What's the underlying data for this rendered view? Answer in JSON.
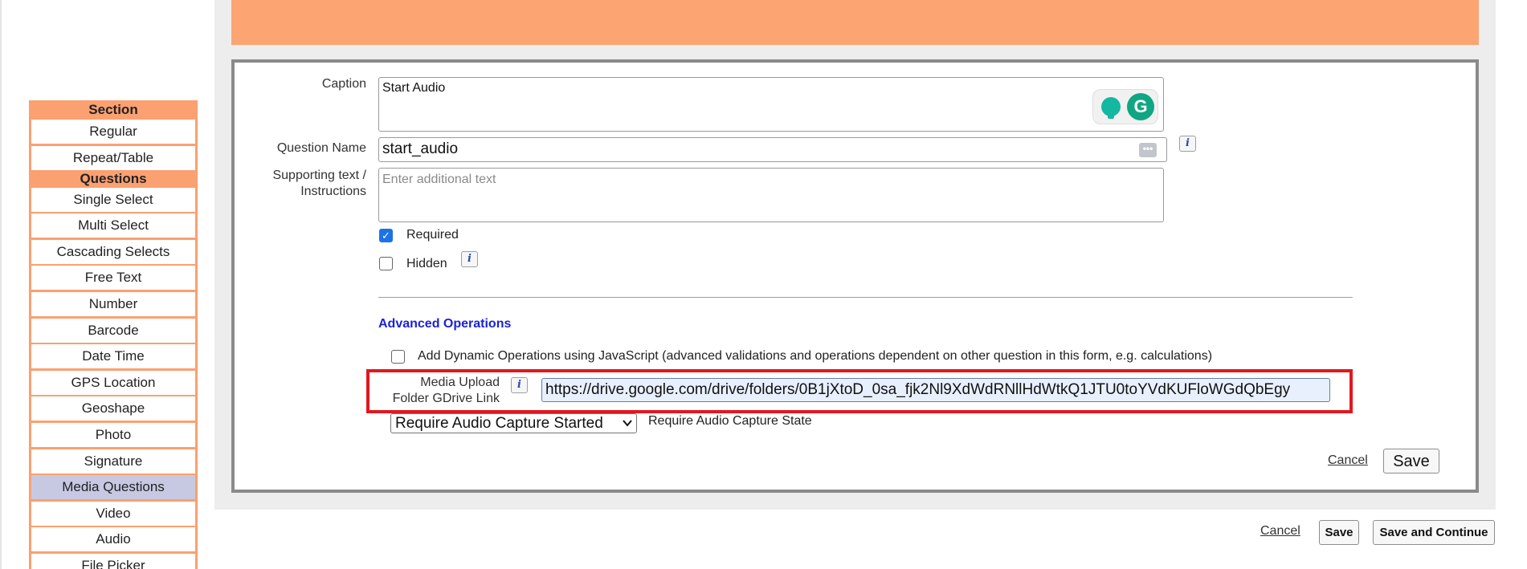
{
  "sidebar": {
    "section_header": "Section",
    "section_items": [
      "Regular",
      "Repeat/Table"
    ],
    "questions_header": "Questions",
    "question_items": [
      "Single Select",
      "Multi Select",
      "Cascading Selects",
      "Free Text",
      "Number",
      "Barcode",
      "Date Time",
      "GPS Location",
      "Geoshape",
      "Photo",
      "Signature",
      "Media Questions",
      "Video",
      "Audio",
      "File Picker"
    ],
    "active_item": "Media Questions"
  },
  "form": {
    "caption_label": "Caption",
    "caption_value": "Start Audio",
    "question_name_label": "Question Name",
    "question_name_value": "start_audio",
    "supporting_label_line1": "Supporting text /",
    "supporting_label_line2": "Instructions",
    "supporting_placeholder": "Enter additional text",
    "required_label": "Required",
    "required_checked": true,
    "hidden_label": "Hidden",
    "hidden_checked": false,
    "advanced_title": "Advanced Operations",
    "dynamic_ops_label": "Add Dynamic Operations using JavaScript (advanced validations and operations dependent on other question in this form, e.g. calculations)",
    "media_label_line1": "Media Upload",
    "media_label_line2": "Folder GDrive Link",
    "media_link_value": "https://drive.google.com/drive/folders/0B1jXtoD_0sa_fjk2Nl9XdWdRNllHdWtkQ1JTU0toYVdKUFloWGdQbEgy",
    "audio_state_selected": "Require Audio Capture Started",
    "audio_state_label": "Require Audio Capture State",
    "cancel_label": "Cancel",
    "save_label": "Save"
  },
  "footer": {
    "cancel_label": "Cancel",
    "save_label": "Save",
    "save_continue_label": "Save and Continue"
  },
  "colors": {
    "sidebar_accent": "#fba070",
    "banner": "#fca572",
    "active_item": "#c7c9e3",
    "highlight_box": "#e2171f",
    "advanced_title": "#1a23d6"
  }
}
